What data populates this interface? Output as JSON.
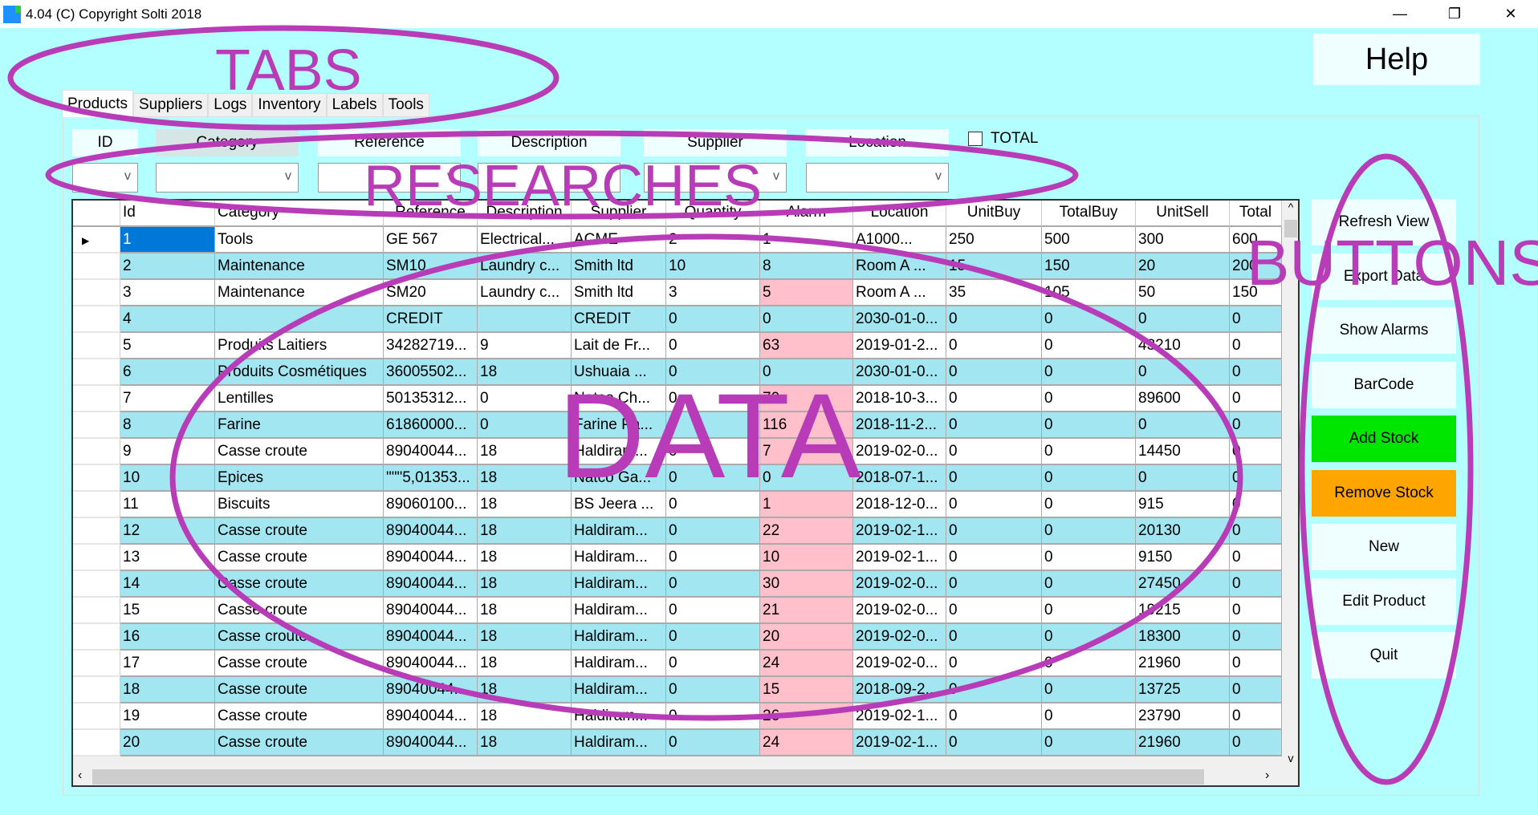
{
  "window": {
    "title": "4.04 (C) Copyright Solti 2018",
    "minimize": "—",
    "restore": "❐",
    "close": "✕"
  },
  "help_label": "Help",
  "tabs": [
    "Products",
    "Suppliers",
    "Logs",
    "Inventory",
    "Labels",
    "Tools"
  ],
  "filters": {
    "labels": [
      "ID",
      "Category",
      "Reference",
      "Description",
      "Supplier",
      "Location"
    ],
    "total_label": "TOTAL",
    "total_checked": false
  },
  "grid": {
    "columns": [
      "Id",
      "Category",
      "Reference",
      "Description",
      "Supplier",
      "Quantity",
      "Alarm",
      "Location",
      "UnitBuy",
      "TotalBuy",
      "UnitSell",
      "Total"
    ],
    "rows": [
      {
        "c": [
          "1",
          "Tools",
          "GE 567",
          "Electrical...",
          "ACME",
          "2",
          "1",
          "A1000...",
          "250",
          "500",
          "300",
          "600"
        ],
        "alarm": false
      },
      {
        "c": [
          "2",
          "Maintenance",
          "SM10",
          "Laundry c...",
          "Smith ltd",
          "10",
          "8",
          "Room A ...",
          "15",
          "150",
          "20",
          "200"
        ],
        "alarm": false
      },
      {
        "c": [
          "3",
          "Maintenance",
          "SM20",
          "Laundry c...",
          "Smith ltd",
          "3",
          "5",
          "Room A ...",
          "35",
          "105",
          "50",
          "150"
        ],
        "alarm": true
      },
      {
        "c": [
          "4",
          "",
          "CREDIT",
          "",
          "CREDIT",
          "0",
          "0",
          "2030-01-0...",
          "0",
          "0",
          "0",
          "0"
        ],
        "alarm": false
      },
      {
        "c": [
          "5",
          "Produits Laitiers",
          "34282719...",
          "9",
          "Lait de Fr...",
          "0",
          "63",
          "2019-01-2...",
          "0",
          "0",
          "43210",
          "0"
        ],
        "alarm": true
      },
      {
        "c": [
          "6",
          "Produits Cosmétiques",
          "36005502...",
          "18",
          "Ushuaia ...",
          "0",
          "0",
          "2030-01-0...",
          "0",
          "0",
          "0",
          "0"
        ],
        "alarm": false
      },
      {
        "c": [
          "7",
          "Lentilles",
          "50135312...",
          "0",
          "Natco Ch...",
          "0",
          "70",
          "2018-10-3...",
          "0",
          "0",
          "89600",
          "0"
        ],
        "alarm": true
      },
      {
        "c": [
          "8",
          "Farine",
          "61860000...",
          "0",
          "Farine Pa...",
          "0",
          "116",
          "2018-11-2...",
          "0",
          "0",
          "0",
          "0"
        ],
        "alarm": true
      },
      {
        "c": [
          "9",
          "Casse croute",
          "89040044...",
          "18",
          "Haldiram...",
          "0",
          "7",
          "2019-02-0...",
          "0",
          "0",
          "14450",
          "0"
        ],
        "alarm": true
      },
      {
        "c": [
          "10",
          "Epices",
          "\"\"\"5,01353...",
          "18",
          "Natco Ga...",
          "0",
          "0",
          "2018-07-1...",
          "0",
          "0",
          "0",
          "0"
        ],
        "alarm": false
      },
      {
        "c": [
          "11",
          "Biscuits",
          "89060100...",
          "18",
          "BS Jeera ...",
          "0",
          "1",
          "2018-12-0...",
          "0",
          "0",
          "915",
          "0"
        ],
        "alarm": true
      },
      {
        "c": [
          "12",
          "Casse croute",
          "89040044...",
          "18",
          "Haldiram...",
          "0",
          "22",
          "2019-02-1...",
          "0",
          "0",
          "20130",
          "0"
        ],
        "alarm": true
      },
      {
        "c": [
          "13",
          "Casse croute",
          "89040044...",
          "18",
          "Haldiram...",
          "0",
          "10",
          "2019-02-1...",
          "0",
          "0",
          "9150",
          "0"
        ],
        "alarm": true
      },
      {
        "c": [
          "14",
          "Casse croute",
          "89040044...",
          "18",
          "Haldiram...",
          "0",
          "30",
          "2019-02-0...",
          "0",
          "0",
          "27450",
          "0"
        ],
        "alarm": true
      },
      {
        "c": [
          "15",
          "Casse croute",
          "89040044...",
          "18",
          "Haldiram...",
          "0",
          "21",
          "2019-02-0...",
          "0",
          "0",
          "19215",
          "0"
        ],
        "alarm": true
      },
      {
        "c": [
          "16",
          "Casse croute",
          "89040044...",
          "18",
          "Haldiram...",
          "0",
          "20",
          "2019-02-0...",
          "0",
          "0",
          "18300",
          "0"
        ],
        "alarm": true
      },
      {
        "c": [
          "17",
          "Casse croute",
          "89040044...",
          "18",
          "Haldiram...",
          "0",
          "24",
          "2019-02-0...",
          "0",
          "0",
          "21960",
          "0"
        ],
        "alarm": true
      },
      {
        "c": [
          "18",
          "Casse croute",
          "89040044...",
          "18",
          "Haldiram...",
          "0",
          "15",
          "2018-09-2...",
          "0",
          "0",
          "13725",
          "0"
        ],
        "alarm": true
      },
      {
        "c": [
          "19",
          "Casse croute",
          "89040044...",
          "18",
          "Haldiram...",
          "0",
          "26",
          "2019-02-1...",
          "0",
          "0",
          "23790",
          "0"
        ],
        "alarm": true
      },
      {
        "c": [
          "20",
          "Casse croute",
          "89040044...",
          "18",
          "Haldiram...",
          "0",
          "24",
          "2019-02-1...",
          "0",
          "0",
          "21960",
          "0"
        ],
        "alarm": true
      }
    ]
  },
  "buttons": [
    "Refresh View",
    "Export Data",
    "Show Alarms",
    "BarCode",
    "Add Stock",
    "Remove Stock",
    "New",
    "Edit Product",
    "Quit"
  ],
  "colors": {
    "background": "#b3ffff",
    "row_alt": "#a2e6f2",
    "alarm": "#ffc0cb",
    "selected": "#0078d7",
    "add_stock": "#00e600",
    "remove_stock": "#ffa500",
    "annotation": "#b83cb8"
  },
  "annotations": [
    "TABS",
    "RESEARCHES",
    "DATA",
    "BUTTONS"
  ]
}
